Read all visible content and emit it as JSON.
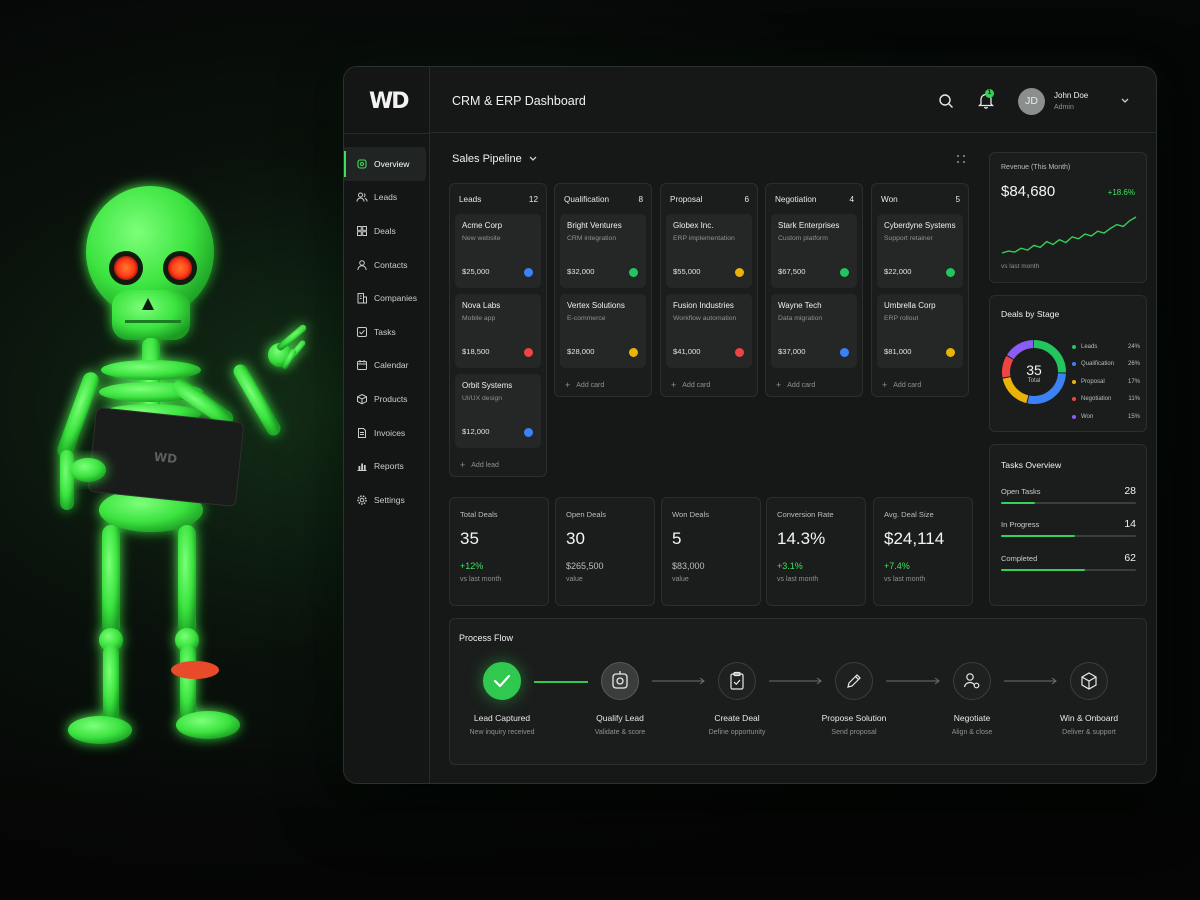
{
  "app": {
    "logo": "WD",
    "title": "CRM & ERP Dashboard",
    "tablet_logo": "WD"
  },
  "user": {
    "initials": "JD",
    "name": "John Doe",
    "role": "Admin",
    "notifications": "1"
  },
  "sidebar": {
    "items": [
      {
        "label": "Overview",
        "icon": "overview-icon",
        "active": true
      },
      {
        "label": "Leads",
        "icon": "users-icon"
      },
      {
        "label": "Deals",
        "icon": "grid-icon"
      },
      {
        "label": "Contacts",
        "icon": "person-icon"
      },
      {
        "label": "Companies",
        "icon": "building-icon"
      },
      {
        "label": "Tasks",
        "icon": "checkbox-icon"
      },
      {
        "label": "Calendar",
        "icon": "calendar-icon"
      },
      {
        "label": "Products",
        "icon": "box-icon"
      },
      {
        "label": "Invoices",
        "icon": "document-icon"
      },
      {
        "label": "Reports",
        "icon": "bar-chart-icon"
      },
      {
        "label": "Settings",
        "icon": "gear-icon"
      }
    ]
  },
  "pipeline": {
    "title": "Sales Pipeline",
    "columns": [
      {
        "name": "Leads",
        "count": "12",
        "add_label": "Add lead",
        "cards": [
          {
            "name": "Acme Corp",
            "sub": "New website",
            "value": "$25,000",
            "dot": "#3b82f6"
          },
          {
            "name": "Nova Labs",
            "sub": "Mobile app",
            "value": "$18,500",
            "dot": "#ef4444"
          },
          {
            "name": "Orbit Systems",
            "sub": "UI/UX design",
            "value": "$12,000",
            "dot": "#3b82f6"
          }
        ]
      },
      {
        "name": "Qualification",
        "count": "8",
        "add_label": "Add card",
        "cards": [
          {
            "name": "Bright Ventures",
            "sub": "CRM integration",
            "value": "$32,000",
            "dot": "#22c55e"
          },
          {
            "name": "Vertex Solutions",
            "sub": "E-commerce",
            "value": "$28,000",
            "dot": "#eab308"
          }
        ]
      },
      {
        "name": "Proposal",
        "count": "6",
        "add_label": "Add card",
        "cards": [
          {
            "name": "Globex Inc.",
            "sub": "ERP implementation",
            "value": "$55,000",
            "dot": "#eab308"
          },
          {
            "name": "Fusion Industries",
            "sub": "Workflow automation",
            "value": "$41,000",
            "dot": "#ef4444"
          }
        ]
      },
      {
        "name": "Negotiation",
        "count": "4",
        "add_label": "Add card",
        "cards": [
          {
            "name": "Stark Enterprises",
            "sub": "Custom platform",
            "value": "$67,500",
            "dot": "#22c55e"
          },
          {
            "name": "Wayne Tech",
            "sub": "Data migration",
            "value": "$37,000",
            "dot": "#3b82f6"
          }
        ]
      },
      {
        "name": "Won",
        "count": "5",
        "add_label": "Add card",
        "cards": [
          {
            "name": "Cyberdyne Systems",
            "sub": "Support retainer",
            "value": "$22,000",
            "dot": "#22c55e"
          },
          {
            "name": "Umbrella Corp",
            "sub": "ERP rollout",
            "value": "$81,000",
            "dot": "#eab308"
          }
        ]
      }
    ]
  },
  "stats": [
    {
      "label": "Total Deals",
      "value": "35",
      "change": "+12%",
      "sub": "vs last month",
      "green": true
    },
    {
      "label": "Open Deals",
      "value": "30",
      "change": "$265,500",
      "sub": "value",
      "green": false
    },
    {
      "label": "Won Deals",
      "value": "5",
      "change": "$83,000",
      "sub": "value",
      "green": false
    },
    {
      "label": "Conversion Rate",
      "value": "14.3%",
      "change": "+3.1%",
      "sub": "vs last month",
      "green": true
    },
    {
      "label": "Avg. Deal Size",
      "value": "$24,114",
      "change": "+7.4%",
      "sub": "vs last month",
      "green": true
    }
  ],
  "revenue": {
    "label": "Revenue (This Month)",
    "value": "$84,680",
    "change": "+18.6%",
    "footer": "vs last month",
    "trend": [
      10,
      12,
      11,
      15,
      13,
      18,
      16,
      22,
      19,
      24,
      21,
      27,
      25,
      30,
      28,
      33,
      31,
      36,
      40,
      38,
      44,
      48
    ]
  },
  "deals_by_stage": {
    "title": "Deals by Stage",
    "total": "35",
    "total_label": "Total",
    "stages": [
      {
        "label": "Leads",
        "pct": "24%",
        "value": 24,
        "color": "#22c55e"
      },
      {
        "label": "Qualification",
        "pct": "26%",
        "value": 26,
        "color": "#3b82f6"
      },
      {
        "label": "Proposal",
        "pct": "17%",
        "value": 17,
        "color": "#eab308"
      },
      {
        "label": "Negotiation",
        "pct": "11%",
        "value": 11,
        "color": "#ef4444"
      },
      {
        "label": "Won",
        "pct": "15%",
        "value": 15,
        "color": "#8b5cf6"
      }
    ]
  },
  "tasks": {
    "title": "Tasks Overview",
    "rows": [
      {
        "label": "Open Tasks",
        "value": "28",
        "fill": 0.25
      },
      {
        "label": "In Progress",
        "value": "14",
        "fill": 0.55
      },
      {
        "label": "Completed",
        "value": "62",
        "fill": 0.62
      }
    ]
  },
  "flow": {
    "title": "Process Flow",
    "steps": [
      {
        "title": "Lead Captured",
        "sub": "New inquiry received",
        "state": "done",
        "icon": "check-icon"
      },
      {
        "title": "Qualify Lead",
        "sub": "Validate & score",
        "state": "current",
        "icon": "target-icon"
      },
      {
        "title": "Create Deal",
        "sub": "Define opportunity",
        "state": "todo",
        "icon": "clipboard-icon"
      },
      {
        "title": "Propose Solution",
        "sub": "Send proposal",
        "state": "todo",
        "icon": "pen-icon"
      },
      {
        "title": "Negotiate",
        "sub": "Align & close",
        "state": "todo",
        "icon": "user-gear-icon"
      },
      {
        "title": "Win & Onboard",
        "sub": "Deliver & support",
        "state": "todo",
        "icon": "cube-icon"
      }
    ]
  }
}
